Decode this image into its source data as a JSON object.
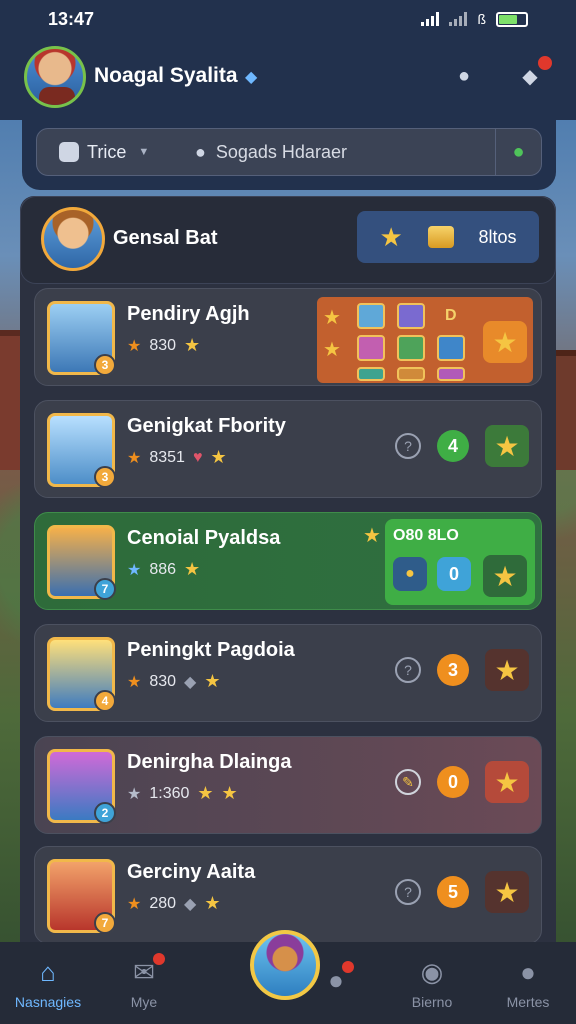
{
  "status_bar": {
    "time": "13:47",
    "signal_icon": "signal-icon",
    "wifi_icon": "wifi-icon",
    "battery_icon": "battery-icon"
  },
  "header": {
    "player_name": "Noagal Syalita",
    "verified_icon": "verified-gem-icon",
    "profile_icon": "profile-icon",
    "chat_icon": "chat-icon"
  },
  "search": {
    "filter_label": "Trice",
    "placeholder": "Sogads Hdaraer"
  },
  "hero": {
    "name": "Gensal Bat",
    "currency_value": "8ltos"
  },
  "cards": [
    {
      "title": "Pendiry Agjh",
      "score": "830",
      "level": "3"
    },
    {
      "title": "Genigkat Fbority",
      "score": "8351",
      "level": "3",
      "count": "4",
      "count_color": "#3fae45"
    },
    {
      "title": "Cenoial Pyaldsa",
      "score": "886",
      "level": "7",
      "bonus_label": "O80 8LO",
      "count": "0",
      "count_color": "#3fa3d8"
    },
    {
      "title": "Peningkt Pagdoia",
      "score": "830",
      "level": "4",
      "count": "3",
      "count_color": "#ef8f1e"
    },
    {
      "title": "Denirgha Dlainga",
      "score": "1:360",
      "level": "2",
      "count": "0",
      "count_color": "#ef8f1e"
    },
    {
      "title": "Gerciny Aaita",
      "score": "280",
      "level": "7",
      "count": "5",
      "count_color": "#ef8f1e"
    }
  ],
  "nav": {
    "items": [
      {
        "label": "Nasnagies",
        "icon": "home-icon"
      },
      {
        "label": "Mye",
        "icon": "mail-icon"
      },
      {
        "label": "",
        "icon": "chat-bubble-icon"
      },
      {
        "label": "Bierno",
        "icon": "gamepad-icon"
      },
      {
        "label": "Mertes",
        "icon": "user-icon"
      }
    ]
  }
}
